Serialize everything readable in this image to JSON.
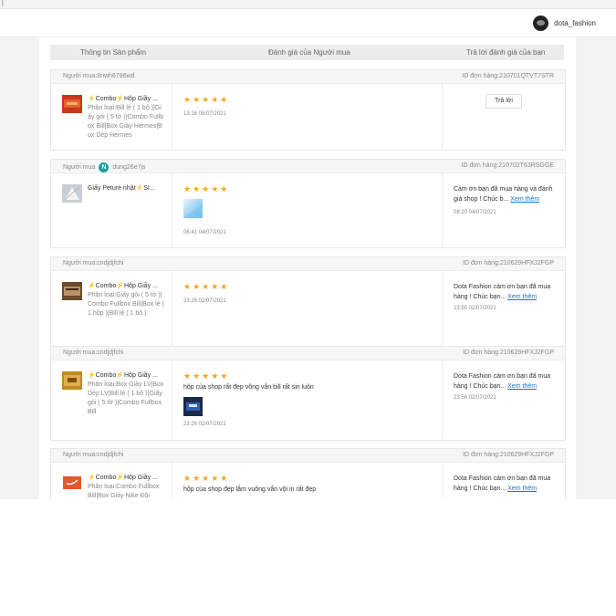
{
  "header": {
    "shop_name": "dota_fashion"
  },
  "table": {
    "col_product": "Thông tin Sản phẩm",
    "col_rating": "Đánh giá của Người mua",
    "col_reply": "Trả lời đánh giá của bạn"
  },
  "reviews": [
    {
      "buyer_label": "Người mua:",
      "buyer": "8nwh6786wd",
      "order_id": "ID đơn hàng:210701QTVT7STR",
      "product_name": "⚡Combo⚡Hộp Giầy ...",
      "variation": "Phân loại:Bill lẻ ( 1 bộ )|Giấy gói ( 5 tờ )|Combo Fullbox Bill|Box Giày Hermes|Box Dép Hermes",
      "stars": "★★★★★",
      "comment": "",
      "time": "13:16 05/07/2021",
      "reply_button": "Trả lời",
      "reply_text": "",
      "reply_more": "",
      "reply_time": ""
    },
    {
      "buyer_label": "Người mua",
      "buyer": "dung26e7js",
      "avatar_letter": "N",
      "order_id": "ID đơn hàng:210702T63RSGGE",
      "product_name": "Giấy Peture nhật⚡SI...",
      "variation": "",
      "stars": "★★★★★",
      "comment": "",
      "time": "06:41 04/07/2021",
      "reply_text": "Cảm ơn bạn đã mua hàng và đánh giá shop ! Chúc b...",
      "reply_more": "Xem thêm",
      "reply_time": "08:20 04/07/2021"
    },
    {
      "buyer_label": "Người mua:",
      "buyer": "cndjdjfchi",
      "order_id": "ID đơn hàng:210629HFXJ2FGP",
      "product_name": "⚡Combo⚡Hộp Giầy ...",
      "variation": "Phân loại:Giấy gói ( 5 tờ )|Combo Fullbox Bill|Box lẻ ( 1 hộp )|Bill lẻ ( 1 bộ )",
      "stars": "★★★★★",
      "comment": "",
      "time": "23:26 02/07/2021",
      "reply_text": "Dota Fashion cảm ơn bạn đã mua hàng ! Chúc bạn...",
      "reply_more": "Xem thêm",
      "reply_time": "23:55 02/07/2021"
    },
    {
      "buyer_label": "Người mua:",
      "buyer": "cndjdjfchi",
      "order_id": "ID đơn hàng:210629HFXJ2FGP",
      "product_name": "⚡Combo⚡Hộp Giầy ...",
      "variation": "Phân loại:Box Giày LV|Box Dép LV|Bill lẻ ( 1 bộ )|Giấy gói ( 5 tờ )|Combo Fullbox Bill",
      "stars": "★★★★★",
      "comment": "hộp của shop rất đẹp vông vắn bill rất sịn luôn",
      "time": "23:26 02/07/2021",
      "reply_text": "Dota Fashion cảm ơn bạn đã mua hàng ! Chúc bạn...",
      "reply_more": "Xem thêm",
      "reply_time": "23:56 02/07/2021"
    },
    {
      "buyer_label": "Người mua:",
      "buyer": "cndjdjfchi",
      "order_id": "ID đơn hàng:210629HFXJ2FGP",
      "product_name": "⚡Combo⚡Hộp Giầy ...",
      "variation": "Phân loại:Combo Fullbox Bill|Box Giày Nike Đôi",
      "stars": "★★★★★",
      "comment": "hộp của shop đẹp lắm vuông vắn vội in rất đẹp",
      "time": "",
      "reply_text": "Dota Fashion cảm ơn bạn đã mua hàng ! Chúc bạn...",
      "reply_more": "Xem thêm",
      "reply_time": ""
    }
  ]
}
